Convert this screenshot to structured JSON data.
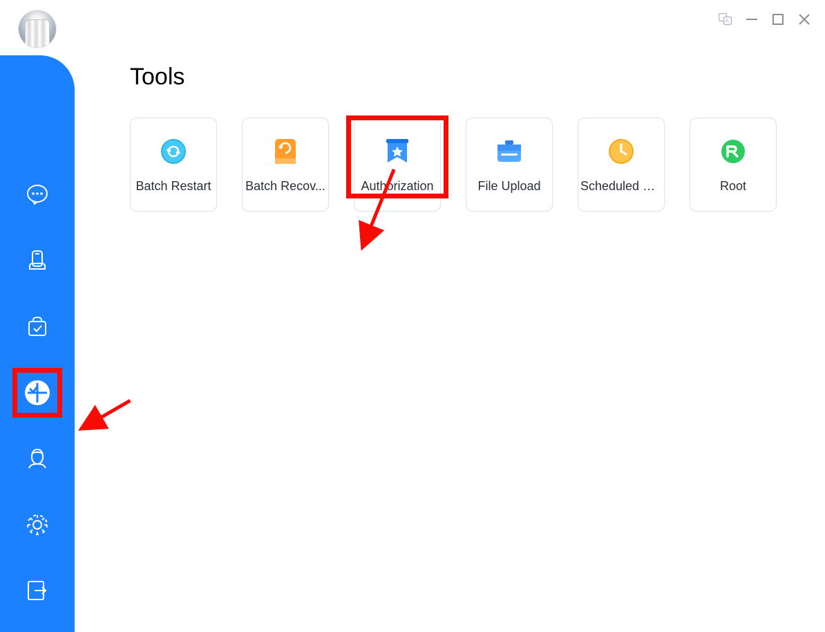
{
  "header": {
    "page_title": "Tools"
  },
  "sidebar": {
    "items": [
      {
        "name": "chat",
        "icon": "chat-icon"
      },
      {
        "name": "devices",
        "icon": "device-icon"
      },
      {
        "name": "apps",
        "icon": "bag-icon"
      },
      {
        "name": "tools",
        "icon": "tools-grid-icon",
        "active": true,
        "highlighted": true
      },
      {
        "name": "profile",
        "icon": "user-icon"
      },
      {
        "name": "settings",
        "icon": "gear-icon"
      },
      {
        "name": "logout",
        "icon": "logout-icon",
        "position": "bottom"
      }
    ]
  },
  "tools": {
    "items": [
      {
        "label": "Batch Restart",
        "icon": "restart-icon",
        "icon_color": "#47c9f5"
      },
      {
        "label": "Batch Recov...",
        "icon": "recovery-icon",
        "icon_color": "#ff9d2b"
      },
      {
        "label": "Authorization",
        "icon": "bookmark-star-icon",
        "icon_color": "#2f8fff",
        "highlighted": true
      },
      {
        "label": "File Upload",
        "icon": "upload-icon",
        "icon_color": "#3e9aff"
      },
      {
        "label": "Scheduled R...",
        "icon": "schedule-icon",
        "icon_color": "#ffb429"
      },
      {
        "label": "Root",
        "icon": "root-icon",
        "icon_color": "#2ecb63"
      }
    ]
  },
  "annotations": {
    "arrow_color": "#f80b05",
    "highlight_color": "#f80b05"
  }
}
